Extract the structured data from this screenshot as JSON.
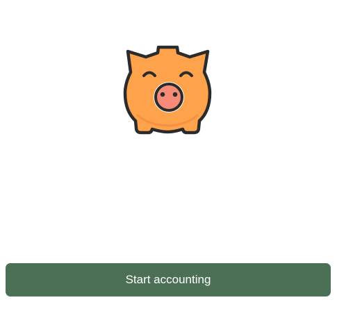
{
  "logo": {
    "icon": "piggy-bank-icon",
    "colors": {
      "body": "#ffa24c",
      "outline": "#2b2b2b",
      "snout": "#f88b77"
    }
  },
  "actions": {
    "start_label": "Start accounting",
    "button_color": "#4b7055",
    "button_text_color": "#ffffff"
  }
}
